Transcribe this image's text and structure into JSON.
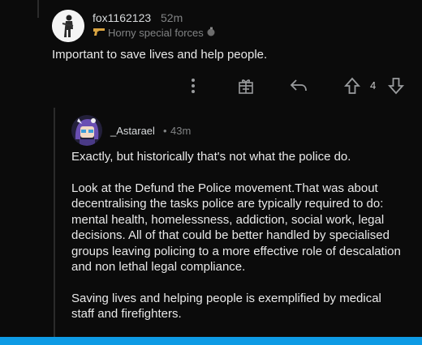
{
  "parent_comment": {
    "username": "fox1162123",
    "timestamp": "52m",
    "flair": "Horny special forces",
    "flair_icons": [
      "gun-emoji",
      "grenade-emoji"
    ],
    "body": "Important to save lives and help people.",
    "votes": "4",
    "actions": [
      "more-options",
      "award",
      "reply",
      "upvote",
      "downvote"
    ]
  },
  "reply_comment": {
    "username": "_Astarael",
    "timestamp": "43m",
    "separator": "•",
    "paragraphs": [
      "Exactly, but historically that's not what the police do.",
      "Look at the Defund the Police movement.That was about decentralising the tasks police are typically required to do: mental health, homelessness, addiction, social work, legal decisions. All of that could be better handled by specialised groups leaving policing to a more effective role of descalation and non lethal legal compliance.",
      "Saving lives and helping people is exemplified by medical staff and firefighters."
    ]
  },
  "colors": {
    "background": "#0b0b0b",
    "text": "#e8e8e8",
    "muted": "#818384",
    "accent_bar": "#0e9be5",
    "flair_icon": "#d9a441"
  }
}
